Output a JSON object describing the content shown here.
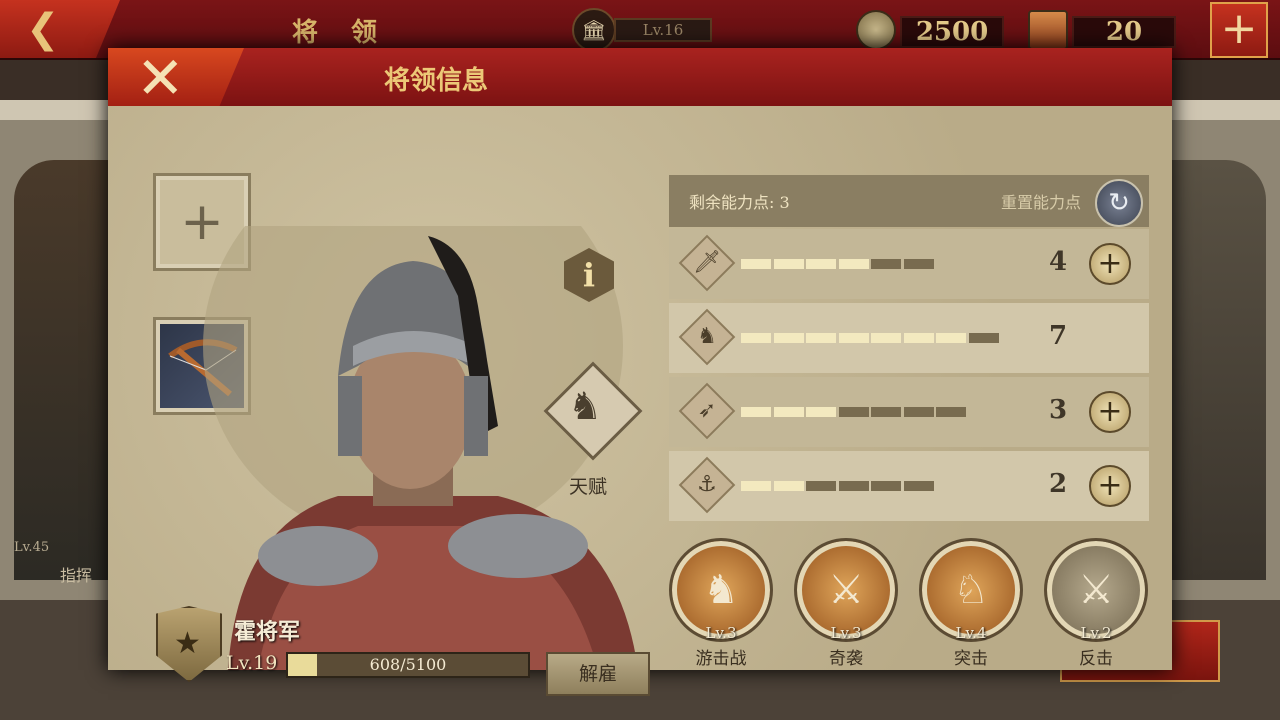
{
  "topbar": {
    "title": "将 领",
    "player_level": "Lv.16",
    "coins": "2500",
    "tokens": "20",
    "add_label": "+"
  },
  "background": {
    "left_card_level": "Lv.45",
    "left_card_label": "指挥"
  },
  "modal": {
    "title": "将领信息",
    "close_label": "✕",
    "talent_label": "天赋",
    "info_label": "i",
    "equip_slot_plus": "+"
  },
  "general": {
    "name": "霍将军",
    "level": "Lv.19",
    "exp_current": 608,
    "exp_max": 5100,
    "exp_text": "608/5100",
    "dismiss_label": "解雇"
  },
  "points": {
    "remaining_label": "剩余能力点: 3",
    "reset_label": "重置能力点"
  },
  "stats": [
    {
      "icon": "sword-icon",
      "glyph": "🗡",
      "filled": 4,
      "total": 6,
      "value": "4",
      "can_add": true
    },
    {
      "icon": "horse-head-icon",
      "glyph": "♞",
      "filled": 7,
      "total": 8,
      "value": "7",
      "can_add": false
    },
    {
      "icon": "bow-icon",
      "glyph": "➶",
      "filled": 3,
      "total": 7,
      "value": "3",
      "can_add": true
    },
    {
      "icon": "anchor-icon",
      "glyph": "⚓",
      "filled": 2,
      "total": 6,
      "value": "2",
      "can_add": true
    }
  ],
  "skills": [
    {
      "icon": "cavalry-skirmish-icon",
      "level": "Lv.3",
      "name": "游击战",
      "style": "orange"
    },
    {
      "icon": "ambush-icon",
      "level": "Lv.3",
      "name": "奇袭",
      "style": "orange"
    },
    {
      "icon": "charge-icon",
      "level": "Lv.4",
      "name": "突击",
      "style": "orange"
    },
    {
      "icon": "counterattack-icon",
      "level": "Lv.2",
      "name": "反击",
      "style": "gray"
    }
  ],
  "colors": {
    "header_red": "#a9231f",
    "accent_gold": "#ecc877",
    "panel_bg": "#d4c8a9"
  }
}
